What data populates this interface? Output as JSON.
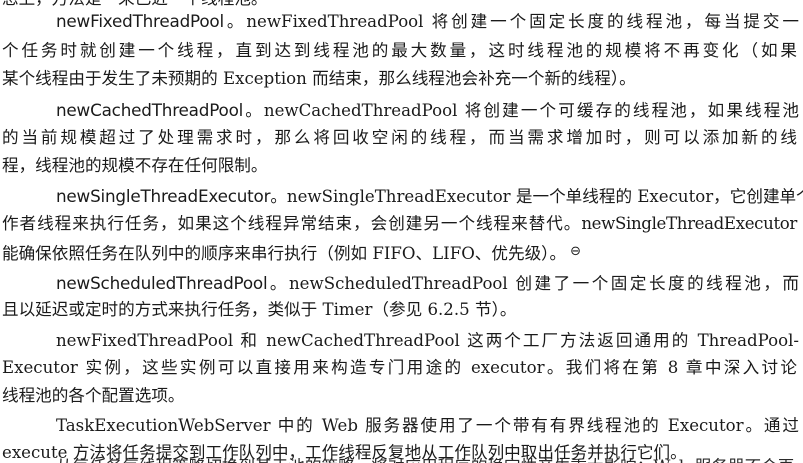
{
  "document": {
    "top_clipped_line": "您上，万法是一采已近一个线程池。",
    "paragraphs": {
      "fixed": {
        "term": "newFixedThreadPool",
        "line1": "。newFixedThreadPool 将创建一个固定长度的线程池，每当提交一",
        "line2": "个任务时就创建一个线程，直到达到线程池的最大数量，这时线程池的规模将不再变化（如果",
        "line3": "某个线程由于发生了未预期的 Exception 而结束，那么线程池会补充一个新的线程）。"
      },
      "cached": {
        "term": "newCachedThreadPool",
        "line1": "。newCachedThreadPool 将创建一个可缓存的线程池，如果线程池",
        "line2": "的当前规模超过了处理需求时，那么将回收空闲的线程，而当需求增加时，则可以添加新的线",
        "line3": "程，线程池的规模不存在任何限制。"
      },
      "single": {
        "term": "newSingleThreadExecutor",
        "line1": "。newSingleThreadExecutor 是一个单线程的 Executor，它创建单个工",
        "line2": "作者线程来执行任务，如果这个线程异常结束，会创建另一个线程来替代。newSingleThreadExecutor",
        "line3": "能确保依照任务在队列中的顺序来串行执行（例如 FIFO、LIFO、优先级）。",
        "footnote_mark": "⊖"
      },
      "scheduled": {
        "term": "newScheduledThreadPool",
        "line1": "。newScheduledThreadPool 创建了一个固定长度的线程池，而",
        "line2": "且以延迟或定时的方式来执行任务，类似于 Timer（参见 6.2.5 节）。"
      },
      "factory": {
        "line1": "newFixedThreadPool 和 newCachedThreadPool 这两个工厂方法返回通用的 ThreadPool-",
        "line2": "Executor 实例，这些实例可以直接用来构造专门用途的 executor。我们将在第 8 章中深入讨论",
        "line3": "线程池的各个配置选项。"
      },
      "webserver": {
        "line1": "TaskExecutionWebServer 中的 Web 服务器使用了一个带有有界线程池的 Executor。通过",
        "line2": "execute 方法将任务提交到工作队列中，工作线程反复地从工作队列中取出任务并执行它们。"
      }
    },
    "bottom_clipped_line": "从每任务每线程策略切换到基于池的策略，将对应用程序的稳定性产生重大影响：Web 服务器不会再"
  }
}
